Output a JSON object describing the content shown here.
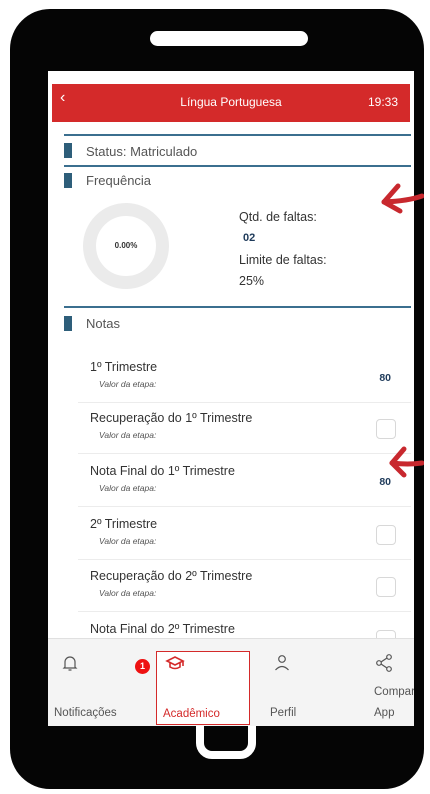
{
  "header": {
    "back_icon": "‹",
    "title": "Língua Portuguesa",
    "time": "19:33"
  },
  "status": {
    "label": "Status: Matriculado"
  },
  "frequencia": {
    "label": "Frequência",
    "percent": "0.00%",
    "faltas_label": "Qtd. de faltas:",
    "faltas_value": "02",
    "limite_label": "Limite de faltas:",
    "limite_value": "25%"
  },
  "notas": {
    "label": "Notas",
    "rows": [
      {
        "title": "1º Trimestre",
        "sub": "Valor da etapa:",
        "value": "80"
      },
      {
        "title": "Recuperação do 1º Trimestre",
        "sub": "Valor da etapa:",
        "value": ""
      },
      {
        "title": "Nota Final do 1º Trimestre",
        "sub": "Valor da etapa:",
        "value": "80"
      },
      {
        "title": "2º Trimestre",
        "sub": "Valor da etapa:",
        "value": ""
      },
      {
        "title": "Recuperação do 2º Trimestre",
        "sub": "Valor da etapa:",
        "value": ""
      },
      {
        "title": "Nota Final do 2º Trimestre",
        "sub": "",
        "value": ""
      }
    ]
  },
  "nav": {
    "items": [
      {
        "label": "Notificações",
        "icon": "bell-icon",
        "badge": "1"
      },
      {
        "label": "Acadêmico",
        "icon": "graduation-cap-icon"
      },
      {
        "label": "Perfil",
        "icon": "user-icon"
      },
      {
        "label": "Compartilhar App",
        "line1": "Compartill",
        "line2": "App",
        "icon": "share-icon"
      }
    ]
  },
  "colors": {
    "accent": "#d42a2a",
    "section_bar": "#2e5e7a",
    "arrow": "#c8282e"
  }
}
